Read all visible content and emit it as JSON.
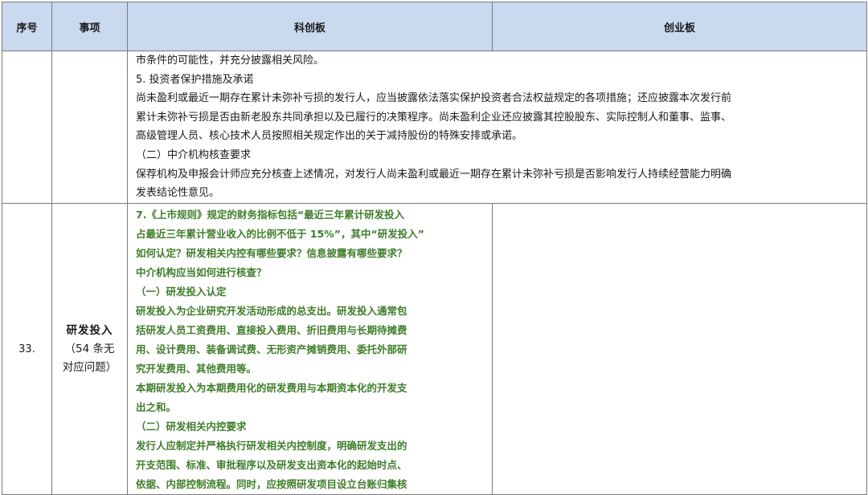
{
  "header": {
    "col_no": "序号",
    "col_item": "事项",
    "col_star": "科创板",
    "col_gem": "创业板"
  },
  "row_prev": {
    "lines": [
      "市条件的可能性，并充分披露相关风险。",
      "5. 投资者保护措施及承诺",
      "尚未盈利或最近一期存在累计未弥补亏损的发行人，应当披露依法落实保护投资者合法权益规定的各项措施；还应披露本次发行前",
      "累计未弥补亏损是否由新老股东共同承担以及已履行的决策程序。尚未盈利企业还应披露其控股股东、实际控制人和董事、监事、",
      "高级管理人员、核心技术人员按照相关规定作出的关于减持股份的特殊安排或承诺。",
      "（二）中介机构核查要求",
      "保荐机构及申报会计师应充分核查上述情况，对发行人尚未盈利或最近一期存在累计未弥补亏损是否影响发行人持续经营能力明确",
      "发表结论性意见。"
    ]
  },
  "row_33": {
    "no": "33.",
    "item_title": "研发投入",
    "item_note_1": "（54 条无",
    "item_note_2": "对应问题）",
    "star_lines": [
      "7.《上市规则》规定的财务指标包括“最近三年累计研发投入",
      "占最近三年累计营业收入的比例不低于 15%”，其中“研发投入”",
      "如何认定？研发相关内控有哪些要求？信息披露有哪些要求？",
      "中介机构应当如何进行核查？",
      "（一）研发投入认定",
      "研发投入为企业研究开发活动形成的总支出。研发投入通常包",
      "括研发人员工资费用、直接投入费用、折旧费用与长期待摊费",
      "用、设计费用、装备调试费、无形资产摊销费用、委托外部研",
      "究开发费用、其他费用等。",
      "本期研发投入为本期费用化的研发费用与本期资本化的开发支",
      "出之和。",
      "（二）研发相关内控要求",
      "发行人应制定并严格执行研发相关内控制度，明确研发支出的",
      "开支范围、标准、审批程序以及研发支出资本化的起始时点、",
      "依据、内部控制流程。同时，应按照研发项目设立台账归集核"
    ],
    "gem": ""
  }
}
